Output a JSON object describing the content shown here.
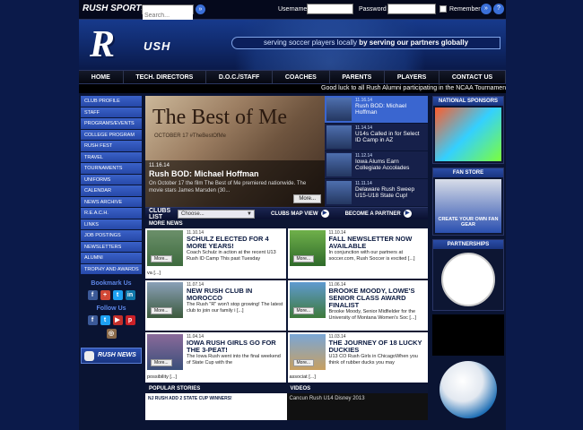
{
  "topbar": {
    "brand": "RUSH SPORTS",
    "search_placeholder": "Search...",
    "username_label": "Username",
    "password_label": "Password",
    "remember_label": "Remember me"
  },
  "header": {
    "logo_letter": "R",
    "logo_word": "USH",
    "tagline_prefix": "serving soccer players locally ",
    "tagline_bold": "by serving our partners globally"
  },
  "nav": [
    "HOME",
    "TECH. DIRECTORS",
    "D.O.C./STAFF",
    "COACHES",
    "PARENTS",
    "PLAYERS",
    "CONTACT US"
  ],
  "ticker": "Good luck to all Rush Alumni participating in the NCAA Tournament in the s",
  "sidebar": [
    "CLUB PROFILE",
    "STAFF",
    "PROGRAMS/EVENTS",
    "COLLEGE PROGRAM",
    "RUSH FEST",
    "TRAVEL",
    "TOURNAMENTS",
    "UNIFORMS",
    "CALENDAR",
    "NEWS ARCHIVE",
    "R.E.A.C.H.",
    "LINKS",
    "JOB POSTINGS",
    "NEWSLETTERS",
    "ALUMNI",
    "TROPHY AND AWARDS"
  ],
  "social": {
    "bookmark": "Bookmark Us",
    "follow": "Follow Us",
    "rush_news": "RUSH NEWS"
  },
  "feature": {
    "movie_title": "The Best of Me",
    "movie_sub": "OCTOBER 17   #TheBestOfMe",
    "date": "11.16.14",
    "title": "Rush BOD: Michael Hoffman",
    "text": "On October 17 the film The Best of Me premiered nationwide. The movie stars James Marsden (30...",
    "more": "More..."
  },
  "feature_list": [
    {
      "date": "11.16.14",
      "title": "Rush BOD: Michael Hoffman"
    },
    {
      "date": "11.14.14",
      "title": "U14s Called in for Select ID Camp in AZ"
    },
    {
      "date": "11.12.14",
      "title": "Iowa Alums Earn Collegiate Accolades"
    },
    {
      "date": "11.11.14",
      "title": "Delaware Rush Sweep U15-U18 State Cup!"
    }
  ],
  "clubs": {
    "label": "CLUBS LIST",
    "select": "Choose...",
    "map": "CLUBS MAP VIEW",
    "partner": "BECOME A PARTNER"
  },
  "more_news": "MORE NEWS",
  "news": [
    {
      "date": "11.10.14",
      "title": "SCHULZ ELECTED FOR 4 MORE YEARS!",
      "text": "Coach Schulz in action at the recent U13 Rush ID Camp This past Tuesday",
      "tail": "va [...]"
    },
    {
      "date": "11.10.14",
      "title": "FALL NEWSLETTER NOW AVAILABLE",
      "text": "In conjunction with our partners at soccer.com, Rush Soccer is excited [...]",
      "tail": ""
    },
    {
      "date": "11.07.14",
      "title": "NEW RUSH CLUB IN MOROCCO",
      "text": "The Rush \"R\" won't stop growing! The latest club to join our family i [...]",
      "tail": ""
    },
    {
      "date": "11.06.14",
      "title": "BROOKE MOODY, LOWE'S SENIOR CLASS AWARD FINALIST",
      "text": "Brooke Moody, Senior Midfielder for the University of Montana Women's Soc [...]",
      "tail": ""
    },
    {
      "date": "11.04.14",
      "title": "IOWA RUSH GIRLS GO FOR THE 3-PEAT!",
      "text": "The Iowa Rush went into the final weekend of State Cup with the",
      "tail": "possibility [...]"
    },
    {
      "date": "11.03.14",
      "title": "THE JOURNEY OF 18 LUCKY DUCKIES",
      "text": "U13 CO Rush Girls in ChicagoWhen you think of rubber ducks you may",
      "tail": "associat [...]"
    }
  ],
  "bottom": {
    "popular": "POPULAR STORIES",
    "videos": "VIDEOS",
    "popular_item": "NJ RUSH ADD 2 STATE CUP WINNERS!",
    "video_item": "Cancun Rush U14 Disney 2013"
  },
  "right": {
    "sponsors": "NATIONAL SPONSORS",
    "store": "FAN STORE",
    "store_text": "CREATE YOUR OWN FAN GEAR",
    "partnerships": "PARTNERSHIPS"
  },
  "more_label": "More..."
}
